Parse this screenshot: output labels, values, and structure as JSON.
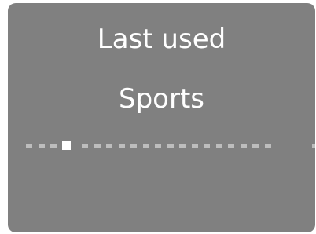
{
  "screen": {
    "header": "Last used",
    "mode": "Sports"
  },
  "page_indicator": {
    "total": 21,
    "active_index": 3,
    "groups": [
      4,
      16,
      1
    ],
    "active_color": "#ffffff",
    "inactive_color": "#bdbdbd"
  },
  "colors": {
    "screen_background": "#808080",
    "text": "#ffffff"
  }
}
